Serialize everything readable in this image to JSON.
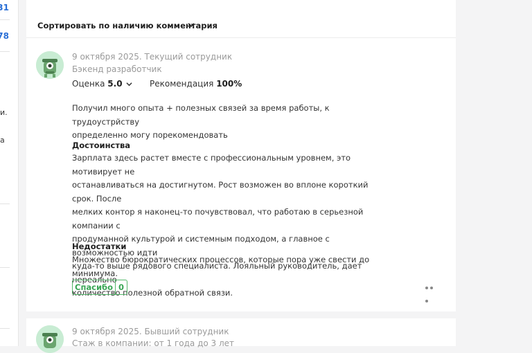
{
  "left_column": {
    "num_top": "31",
    "num_second": "78",
    "frag_a": "и.",
    "frag_b": "а"
  },
  "sort": {
    "label": "Сортировать по наличию комментария"
  },
  "reviews": [
    {
      "date_status": "9 октября 2025. Текущий сотрудник",
      "position": "Бэкенд разработчик",
      "rating_label": "Оценка",
      "rating_value": "5.0",
      "recommend_label": "Рекомендация",
      "recommend_value": "100%",
      "comment_lines": [
        "Получил много опыта + полезных связей за время работы, к трудоустрйству",
        "определенно могу порекомендовать"
      ],
      "pros_title": "Достоинства",
      "pros_lines": [
        "Зарплата здесь растет вместе с профессиональным уровнем, это мотивирует не",
        "останавливаться на достигнутом. Рост возможен во вплоне короткий срок. После",
        "мелких контор я наконец-то почувствовал, что работаю в серьезной компании с",
        "продуманной культурой и системным подходом, а главное с возможностью идти",
        "куда-то выше рядового специалиста. Лояльный руководитель, дает нереально",
        "количество полезной обратной связи."
      ],
      "cons_title": "Недостатки",
      "cons_lines": [
        "Множество бюрократических процессов, которые пора уже свести до минимума."
      ],
      "thanks_label": "Спасибо",
      "thanks_count": "0"
    },
    {
      "date_status": "9 октября 2025. Бывший сотрудник",
      "position": "Стаж в компании: от 1 года до 3 лет"
    }
  ],
  "colors": {
    "accent_green": "#3aa655",
    "link_blue": "#2a6fd6",
    "avatar_bg": "#c8ecd3"
  },
  "icons": [
    "chevron-down-icon",
    "avatar-robot-icon",
    "more-dots-icon"
  ]
}
